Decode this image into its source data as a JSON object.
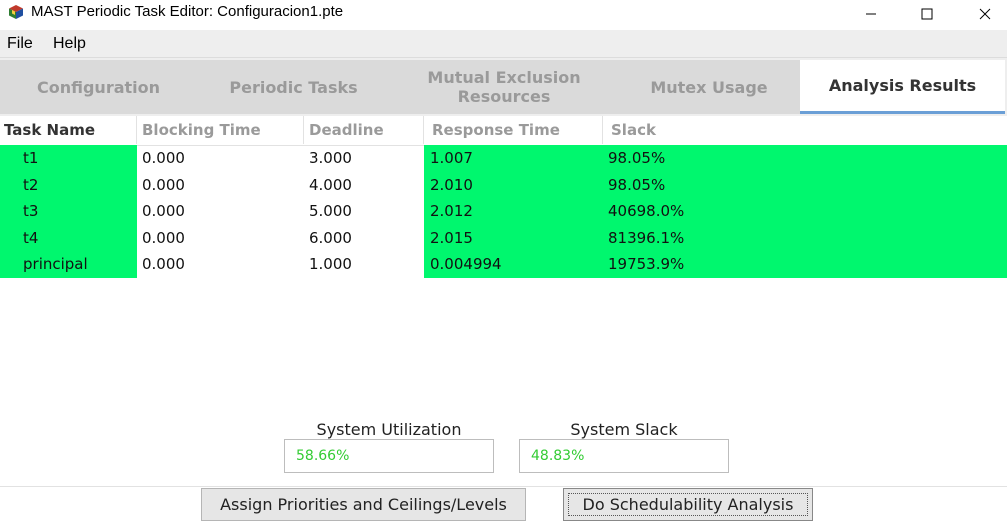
{
  "window": {
    "title": "MAST Periodic Task Editor: Configuracion1.pte",
    "icon": "app-cube-icon"
  },
  "menu": {
    "items": [
      "File",
      "Help"
    ]
  },
  "tabs": [
    {
      "label": "Configuration",
      "active": false
    },
    {
      "label": "Periodic Tasks",
      "active": false
    },
    {
      "label": "Mutual Exclusion\nResources",
      "active": false
    },
    {
      "label": "Mutex Usage",
      "active": false
    },
    {
      "label": "Analysis Results",
      "active": true
    }
  ],
  "table": {
    "columns": [
      "Task Name",
      "Blocking Time",
      "Deadline",
      "Response Time",
      "Slack"
    ],
    "rows": [
      [
        "t1",
        "0.000",
        "3.000",
        "1.007",
        "98.05%"
      ],
      [
        "t2",
        "0.000",
        "4.000",
        "2.010",
        "98.05%"
      ],
      [
        "t3",
        "0.000",
        "5.000",
        "2.012",
        "40698.0%"
      ],
      [
        "t4",
        "0.000",
        "6.000",
        "2.015",
        "81396.1%"
      ],
      [
        "principal",
        "0.000",
        "1.000",
        "0.004994",
        "19753.9%"
      ]
    ],
    "highlight_color": "#00f76e"
  },
  "summary": {
    "utilization_label": "System Utilization",
    "utilization_value": "58.66%",
    "slack_label": "System Slack",
    "slack_value": "48.83%",
    "value_color": "#33cc33"
  },
  "buttons": {
    "assign_label": "Assign Priorities and Ceilings/Levels",
    "analysis_label": "Do Schedulability Analysis"
  }
}
